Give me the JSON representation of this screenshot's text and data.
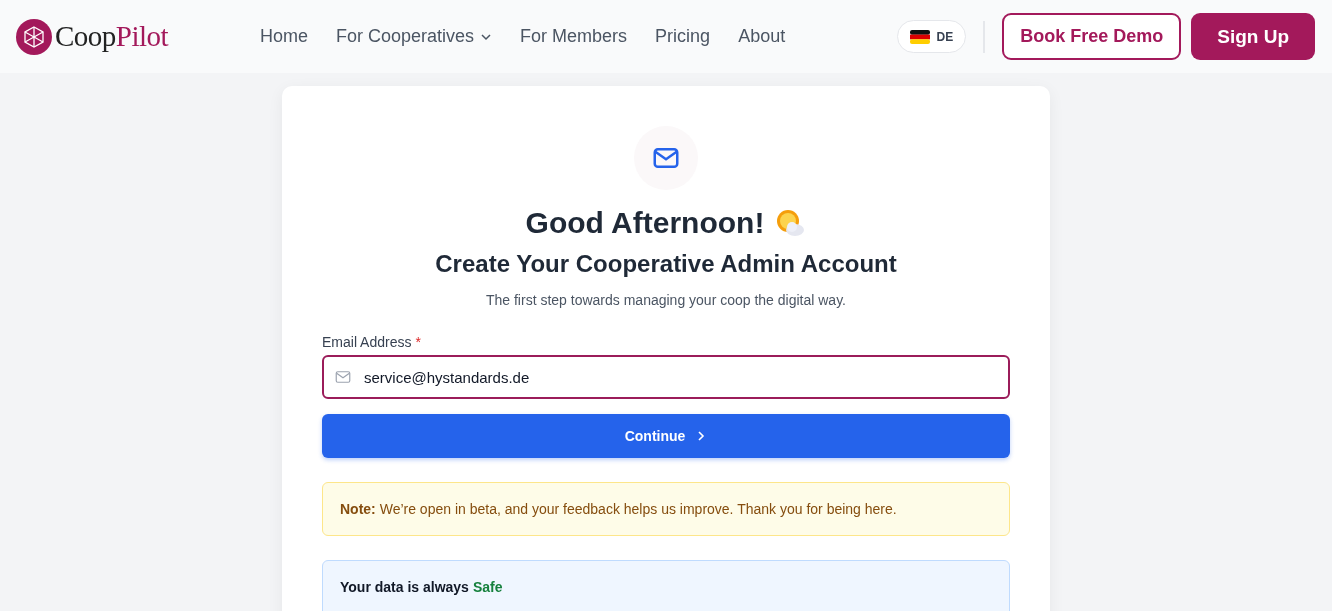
{
  "header": {
    "logo": {
      "part_1": "Coop",
      "part_2": "Pilot"
    },
    "nav": [
      {
        "label": "Home",
        "has_dropdown": false
      },
      {
        "label": "For Cooperatives",
        "has_dropdown": true
      },
      {
        "label": "For Members",
        "has_dropdown": false
      },
      {
        "label": "Pricing",
        "has_dropdown": false
      },
      {
        "label": "About",
        "has_dropdown": false
      }
    ],
    "language": "DE",
    "demo_button": "Book Free Demo",
    "signup_button": "Sign Up"
  },
  "card": {
    "greeting": "Good Afternoon!",
    "title": "Create Your Cooperative Admin Account",
    "subtitle": "The first step towards managing your coop the digital way.",
    "email": {
      "label": "Email Address",
      "required": "*",
      "value": "service@hystandards.de"
    },
    "continue_button": "Continue",
    "note": "**Note:** We’re open in beta, and your feedback helps us improve. Thank you for being here.",
    "safety": {
      "title": "Your data is always",
      "highlight": "Safe"
    }
  }
}
